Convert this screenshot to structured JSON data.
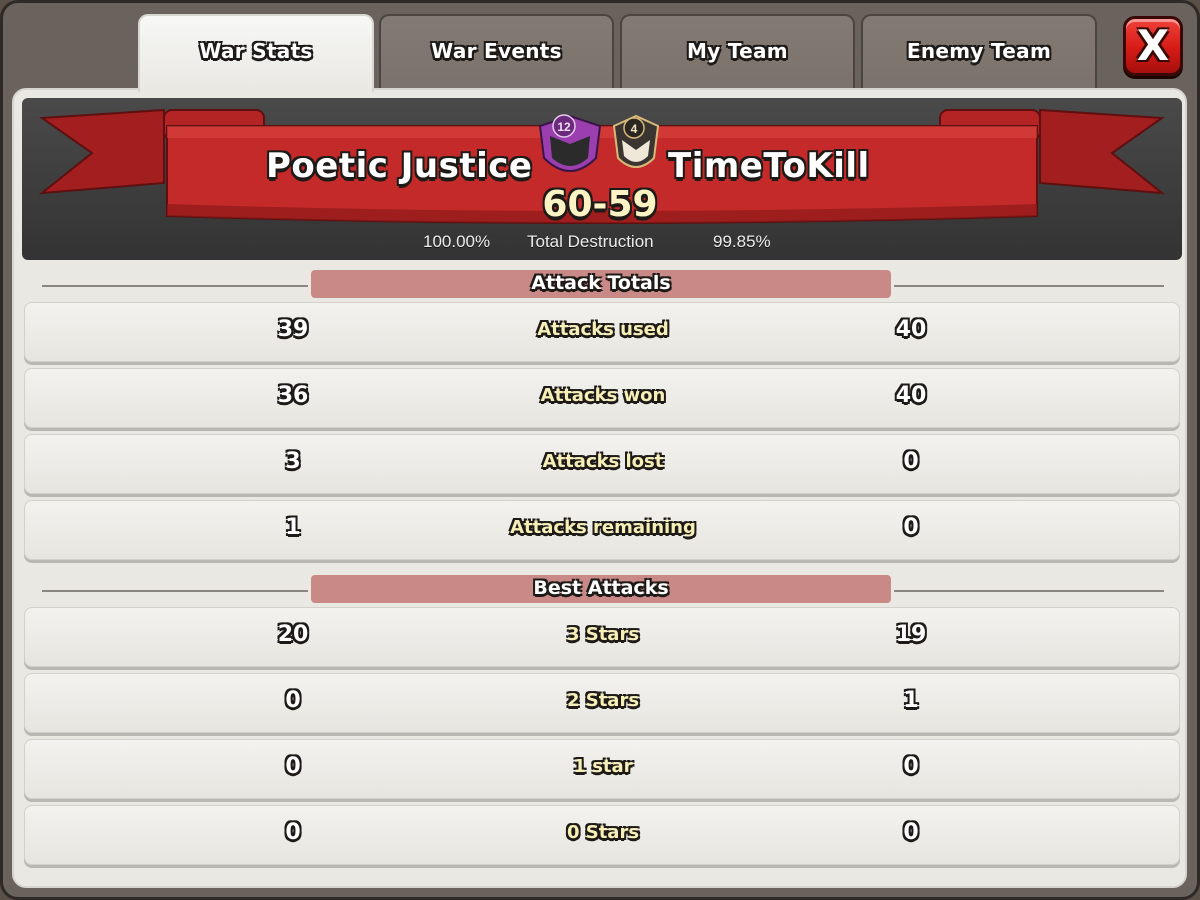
{
  "tabs": [
    {
      "label": "War Stats",
      "active": true
    },
    {
      "label": "War Events",
      "active": false
    },
    {
      "label": "My Team",
      "active": false
    },
    {
      "label": "Enemy Team",
      "active": false
    }
  ],
  "close_button": {
    "label": "X",
    "icon": "close-icon"
  },
  "header": {
    "clan_left": {
      "name": "Poetic Justice",
      "level": "12",
      "badge_color": "#9b3fb0"
    },
    "clan_right": {
      "name": "TimeToKill",
      "level": "4",
      "badge_color": "#3a3530"
    },
    "score": "60-59",
    "destruction_left": "100.00%",
    "destruction_label": "Total Destruction",
    "destruction_right": "99.85%"
  },
  "attack_totals": {
    "title": "Attack Totals",
    "rows": [
      {
        "left": "39",
        "label": "Attacks used",
        "right": "40"
      },
      {
        "left": "36",
        "label": "Attacks won",
        "right": "40"
      },
      {
        "left": "3",
        "label": "Attacks lost",
        "right": "0"
      },
      {
        "left": "1",
        "label": "Attacks remaining",
        "right": "0"
      }
    ]
  },
  "best_attacks": {
    "title": "Best Attacks",
    "rows": [
      {
        "left": "20",
        "label": "3 Stars",
        "right": "19"
      },
      {
        "left": "0",
        "label": "2 Stars",
        "right": "1"
      },
      {
        "left": "0",
        "label": "1 star",
        "right": "0"
      },
      {
        "left": "0",
        "label": "0 Stars",
        "right": "0"
      }
    ]
  },
  "colors": {
    "banner_red": "#c42a2a",
    "section_header": "#c98a87",
    "label_yellow": "#f7efb8",
    "close_red": "#d61b16"
  }
}
